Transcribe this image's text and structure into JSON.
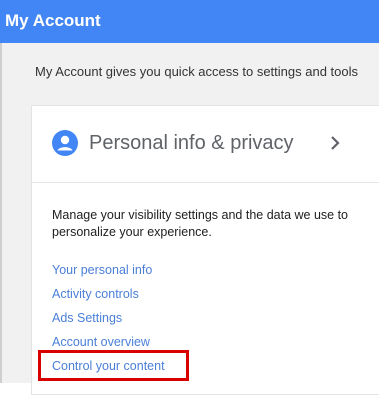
{
  "header": {
    "title": "My Account",
    "background": "#4285f4"
  },
  "intro_text": "My Account gives you quick access to settings and tools",
  "card": {
    "icon": "person-icon",
    "title": "Personal info & privacy",
    "chevron": "chevron-right-icon",
    "description": "Manage your visibility settings and the data we use to personalize your experience.",
    "links": [
      "Your personal info",
      "Activity controls",
      "Ads Settings",
      "Account overview",
      "Control your content"
    ],
    "link_color": "#4a7fd8"
  },
  "highlight": {
    "target": "Control your content",
    "color": "#d90000"
  }
}
